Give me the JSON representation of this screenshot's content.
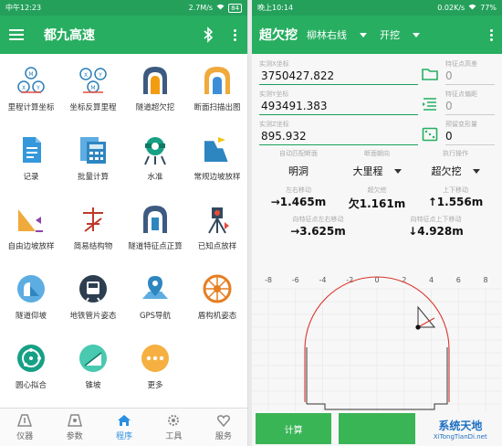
{
  "left": {
    "status": {
      "time": "中午12:23",
      "net": "2.7M/s",
      "battery": "84"
    },
    "title": "都九高速",
    "grid": [
      {
        "label": "里程计算坐标",
        "icon": "mileage-to-coord-icon"
      },
      {
        "label": "坐标反算里程",
        "icon": "coord-to-mileage-icon"
      },
      {
        "label": "隧道超欠挖",
        "icon": "tunnel-overbreak-icon"
      },
      {
        "label": "断面扫描出图",
        "icon": "section-scan-icon"
      },
      {
        "label": "记录",
        "icon": "record-icon"
      },
      {
        "label": "批量计算",
        "icon": "batch-calc-icon"
      },
      {
        "label": "水准",
        "icon": "level-icon"
      },
      {
        "label": "常规边坡放样",
        "icon": "slope-stakeout-icon"
      },
      {
        "label": "自由边坡放样",
        "icon": "free-slope-icon"
      },
      {
        "label": "简易结构物",
        "icon": "simple-structure-icon"
      },
      {
        "label": "隧道特征点正算",
        "icon": "tunnel-feature-icon"
      },
      {
        "label": "已知点放样",
        "icon": "known-point-icon"
      },
      {
        "label": "隧道仰坡",
        "icon": "tunnel-slope-icon"
      },
      {
        "label": "地铁管片姿态",
        "icon": "subway-segment-icon"
      },
      {
        "label": "GPS导航",
        "icon": "gps-nav-icon"
      },
      {
        "label": "盾构机姿态",
        "icon": "shield-machine-icon"
      },
      {
        "label": "圆心拟合",
        "icon": "circle-fit-icon"
      },
      {
        "label": "锥坡",
        "icon": "cone-slope-icon"
      },
      {
        "label": "更多",
        "icon": "more-icon"
      }
    ],
    "nav": [
      {
        "label": "仪器",
        "icon": "instrument-icon"
      },
      {
        "label": "参数",
        "icon": "params-icon"
      },
      {
        "label": "程序",
        "icon": "program-icon",
        "active": true
      },
      {
        "label": "工具",
        "icon": "tools-icon"
      },
      {
        "label": "服务",
        "icon": "service-icon"
      }
    ]
  },
  "right": {
    "status": {
      "time": "晚上10:14",
      "net": "0.02K/s",
      "battery": "77%"
    },
    "title": "超欠挖",
    "line_select": "柳林右线",
    "mode_select": "开挖",
    "fields": {
      "x": {
        "cap": "实测X坐标",
        "val": "3750427.822"
      },
      "y": {
        "cap": "实测Y坐标",
        "val": "493491.383"
      },
      "z": {
        "cap": "实测Z坐标",
        "val": "895.932"
      },
      "feat_h": {
        "cap": "特征点高差",
        "val": "0"
      },
      "feat_off": {
        "cap": "特征点偏距",
        "val": "0"
      },
      "reserve": {
        "cap": "预留变形量",
        "val": "0"
      }
    },
    "match": {
      "cap": "自动匹配断面",
      "val": "明洞"
    },
    "direction": {
      "cap": "断面朝向",
      "val": "大里程"
    },
    "operation": {
      "cap": "执行操作",
      "val": "超欠挖"
    },
    "results": {
      "lr": {
        "cap": "左右移动",
        "val": "→1.465m"
      },
      "ob": {
        "cap": "超欠挖",
        "val": "欠1.161m"
      },
      "ud": {
        "cap": "上下移动",
        "val": "↑1.556m"
      },
      "lr2": {
        "cap": "向特征点左右移动",
        "val": "→3.625m"
      },
      "ud2": {
        "cap": "向特征点上下移动",
        "val": "↓4.928m"
      }
    },
    "axis_ticks": [
      "-8",
      "-6",
      "-4",
      "-2",
      "0",
      "2",
      "4",
      "6",
      "8"
    ],
    "buttons": {
      "calc": "计算"
    },
    "watermark": "系统天地",
    "watermark_url": "XiTongTianDi.net"
  }
}
